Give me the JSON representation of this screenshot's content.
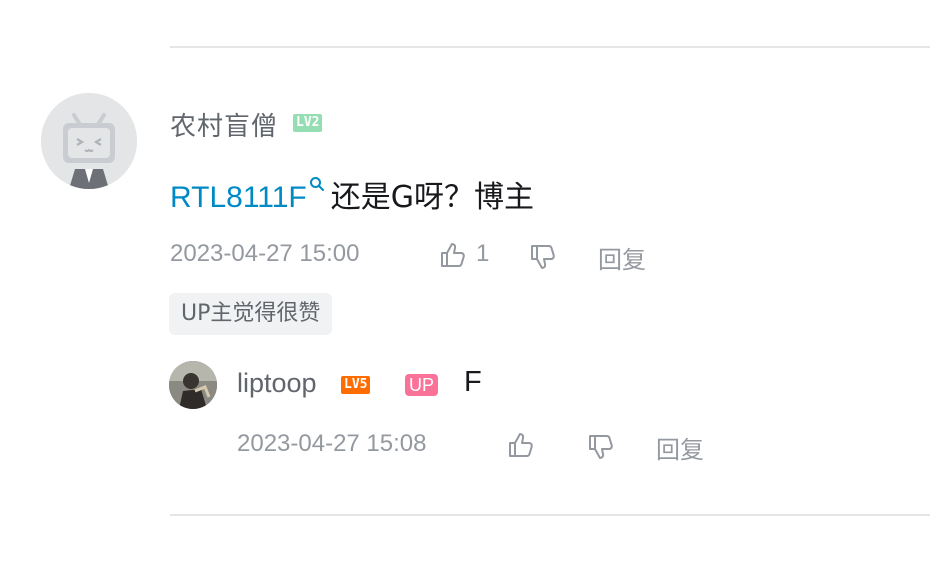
{
  "comment": {
    "username": "农村盲僧",
    "level": "LV2",
    "text_link": "RTL8111F",
    "text_rest": "还是G呀？博主",
    "timestamp": "2023-04-27 15:00",
    "like_count": "1",
    "reply_label": "回复",
    "tag": "UP主觉得很赞"
  },
  "reply": {
    "username": "liptoop",
    "level": "LV5",
    "up_badge": "UP",
    "text": "F",
    "timestamp": "2023-04-27 15:08",
    "reply_label": "回复"
  },
  "colors": {
    "link": "#008ac5",
    "lv2": "#95ddb2",
    "lv5": "#ff6c00",
    "up_badge": "#fb7299",
    "meta": "#9499a0"
  }
}
